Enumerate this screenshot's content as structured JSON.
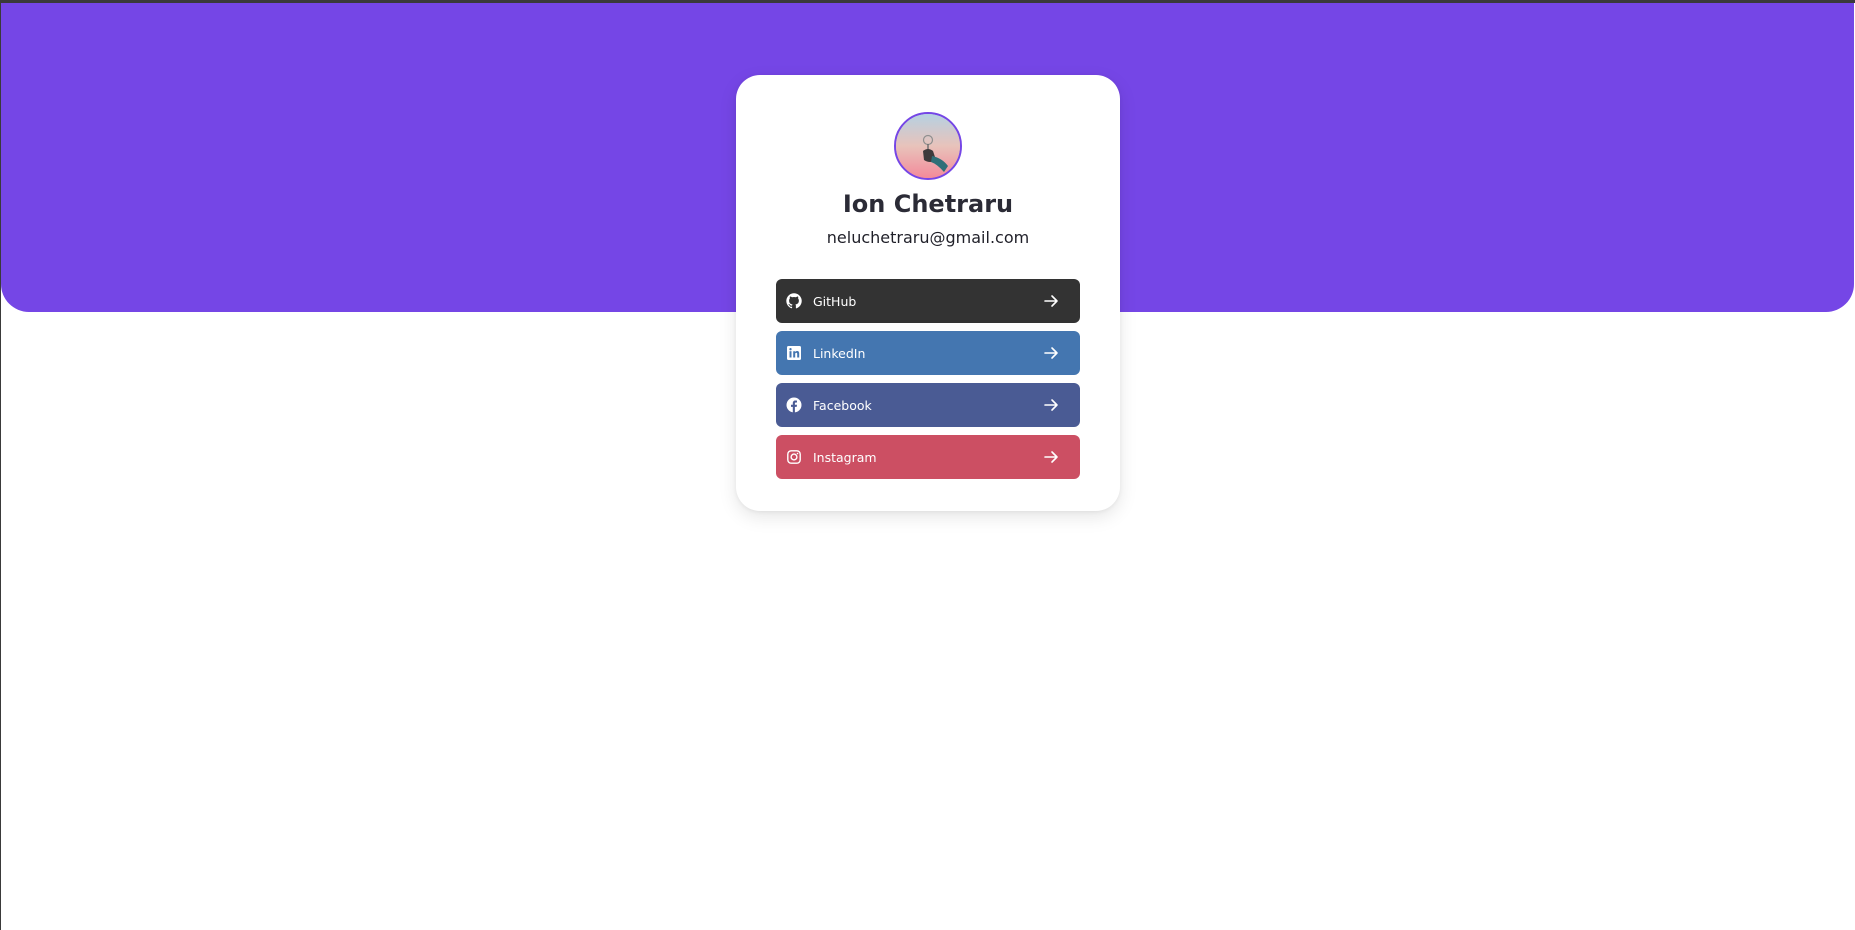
{
  "theme": {
    "hero_color": "#7546e6",
    "avatar_ring_color": "#7546e6"
  },
  "profile": {
    "name": "Ion Chetraru",
    "email": "neluchetraru@gmail.com",
    "avatar_icon": "profile-photo"
  },
  "links": [
    {
      "label": "GitHub",
      "icon": "github-icon",
      "color": "#333333",
      "action_icon": "arrow-right-icon"
    },
    {
      "label": "LinkedIn",
      "icon": "linkedin-icon",
      "color": "#4476b0",
      "action_icon": "arrow-right-icon"
    },
    {
      "label": "Facebook",
      "icon": "facebook-icon",
      "color": "#4a5b94",
      "action_icon": "arrow-right-icon"
    },
    {
      "label": "Instagram",
      "icon": "instagram-icon",
      "color": "#cc4f63",
      "action_icon": "arrow-right-icon"
    }
  ]
}
